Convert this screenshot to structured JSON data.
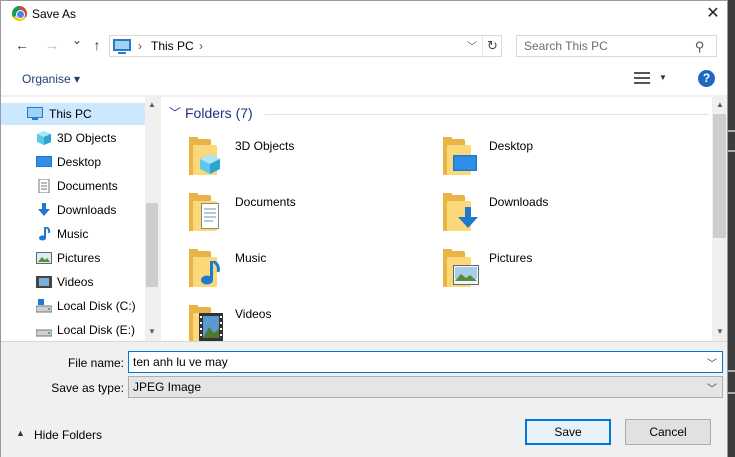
{
  "window": {
    "title": "Save As",
    "close_icon": "close-icon",
    "app_icon": "chrome-icon"
  },
  "navigation": {
    "back_icon": "←",
    "forward_icon": "→",
    "recent_icon": "⌄",
    "up_icon": "↑",
    "address": {
      "location": "This PC",
      "separator": "›"
    },
    "search": {
      "placeholder": "Search This PC"
    }
  },
  "toolbar": {
    "organise_label": "Organise ▾",
    "help_label": "?"
  },
  "sidebar": {
    "items": [
      {
        "label": "This PC",
        "icon": "pc-icon",
        "selected": true
      },
      {
        "label": "3D Objects",
        "icon": "cube-icon"
      },
      {
        "label": "Desktop",
        "icon": "desktop-icon"
      },
      {
        "label": "Documents",
        "icon": "document-icon"
      },
      {
        "label": "Downloads",
        "icon": "download-icon"
      },
      {
        "label": "Music",
        "icon": "music-icon"
      },
      {
        "label": "Pictures",
        "icon": "picture-icon"
      },
      {
        "label": "Videos",
        "icon": "video-icon"
      },
      {
        "label": "Local Disk (C:)",
        "icon": "drive-icon"
      },
      {
        "label": "Local Disk (E:)",
        "icon": "drive-icon"
      }
    ]
  },
  "content": {
    "group_header": "Folders (7)",
    "folders": [
      {
        "label": "3D Objects",
        "overlay": "cube"
      },
      {
        "label": "Desktop",
        "overlay": "desktop"
      },
      {
        "label": "Documents",
        "overlay": "document"
      },
      {
        "label": "Downloads",
        "overlay": "download"
      },
      {
        "label": "Music",
        "overlay": "music"
      },
      {
        "label": "Pictures",
        "overlay": "picture"
      },
      {
        "label": "Videos",
        "overlay": "video"
      }
    ]
  },
  "form": {
    "file_name_label": "File name:",
    "file_name_value": "ten anh lu ve may",
    "save_type_label": "Save as type:",
    "save_type_value": "JPEG Image"
  },
  "footer": {
    "hide_folders_label": "Hide Folders",
    "save_label": "Save",
    "cancel_label": "Cancel"
  },
  "colors": {
    "accent": "#0078d7",
    "selection": "#cce8ff",
    "folder": "#fbd879",
    "link": "#1e3287"
  }
}
